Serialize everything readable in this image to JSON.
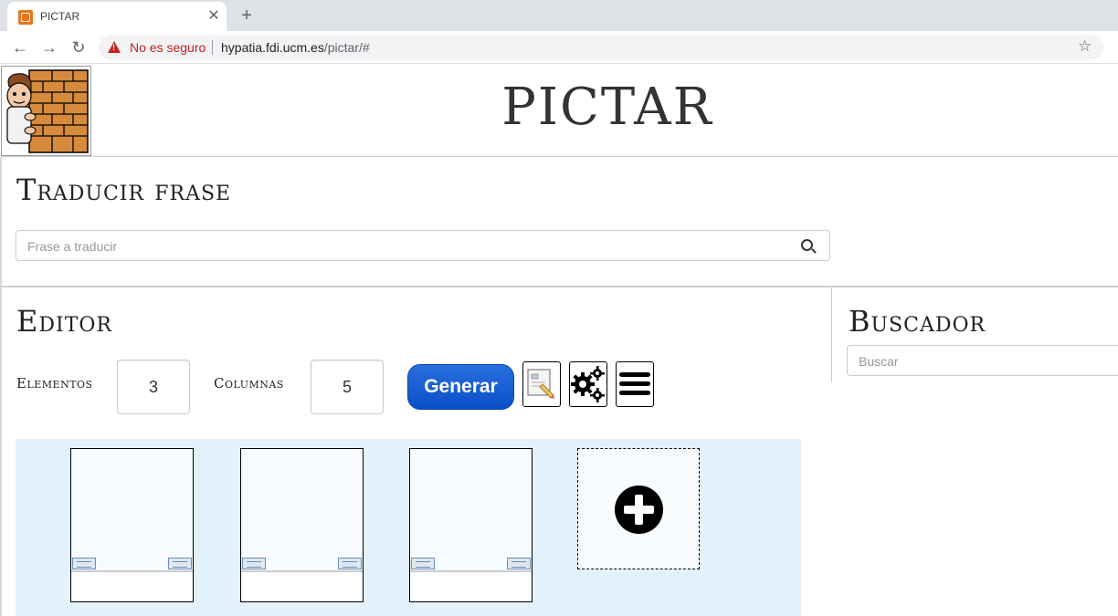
{
  "browser": {
    "tab_title": "PICTAR",
    "tab_close": "✕",
    "new_tab": "+",
    "back": "←",
    "forward": "→",
    "reload": "↻",
    "security_text": "No es seguro",
    "url_host": "hypatia.fdi.ucm.es",
    "url_path": "/pictar/#",
    "bookmark_star": "☆"
  },
  "header": {
    "site_title": "PICTAR"
  },
  "traducir": {
    "title": "Traducir frase",
    "placeholder": "Frase a traducir"
  },
  "editor": {
    "title": "Editor",
    "elementos_label": "Elementos",
    "elementos_value": "3",
    "columnas_label": "Columnas",
    "columnas_value": "5",
    "generar_label": "Generar",
    "icons": [
      "edit-picto-icon",
      "settings-gears-icon",
      "menu-icon"
    ],
    "cards": [
      {},
      {},
      {}
    ]
  },
  "buscador": {
    "title": "Buscador",
    "placeholder": "Buscar"
  },
  "colors": {
    "generar_button": "#1a5fd6",
    "editor_bg": "#e3f1fc",
    "insecure_red": "#c5221f"
  }
}
